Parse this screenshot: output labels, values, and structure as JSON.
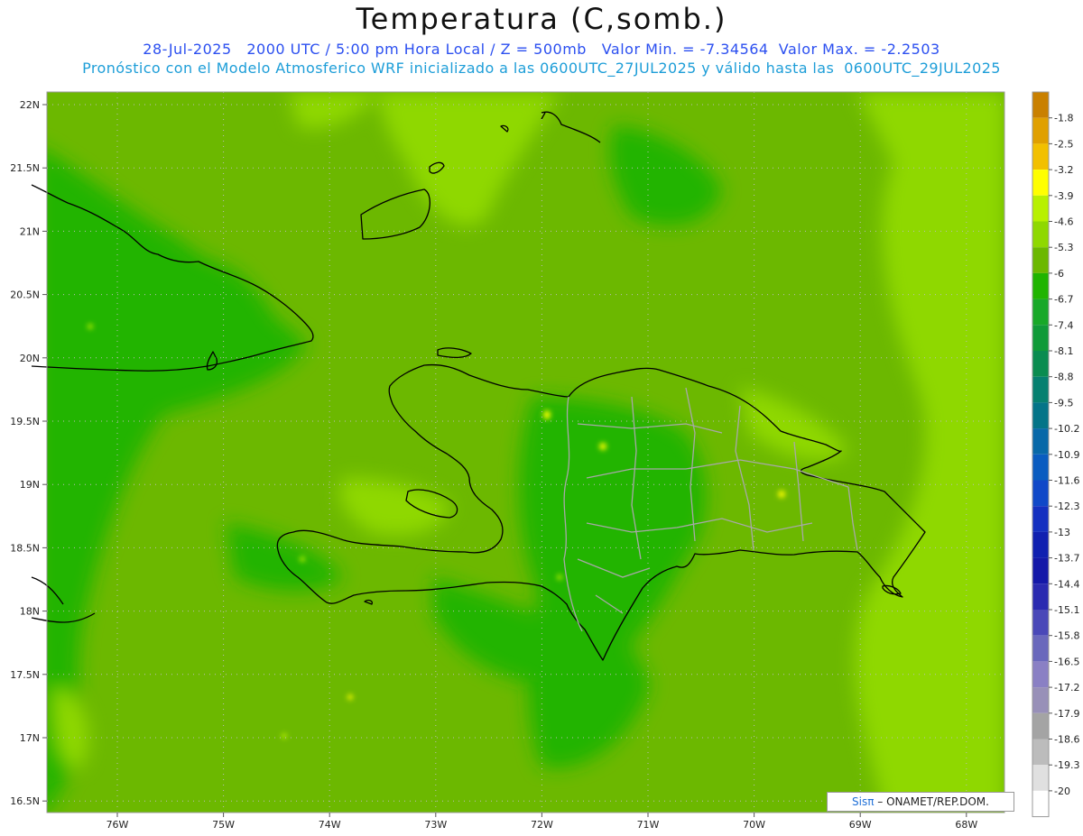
{
  "header": {
    "title": "Temperatura (C,somb.)",
    "line1": "28-Jul-2025   2000 UTC / 5:00 pm Hora Local / Z = 500mb   Valor Min. = -7.34564  Valor Max. = -2.2503",
    "line2": "Pronóstico con el Modelo Atmosferico WRF inicializado a las 0600UTC_27JUL2025 y válido hasta las  0600UTC_29JUL2025"
  },
  "axes": {
    "lat_labels": [
      "22N",
      "21.5N",
      "21N",
      "20.5N",
      "20N",
      "19.5N",
      "19N",
      "18.5N",
      "18N",
      "17.5N",
      "17N",
      "16.5N"
    ],
    "lon_labels": [
      "76W",
      "75W",
      "74W",
      "73W",
      "72W",
      "71W",
      "70W",
      "69W",
      "68W"
    ]
  },
  "legend": {
    "labels": [
      "-1.8",
      "-2.5",
      "-3.2",
      "-3.9",
      "-4.6",
      "-5.3",
      "-6",
      "-6.7",
      "-7.4",
      "-8.1",
      "-8.8",
      "-9.5",
      "-10.2",
      "-10.9",
      "-11.6",
      "-12.3",
      "-13",
      "-13.7",
      "-14.4",
      "-15.1",
      "-15.8",
      "-16.5",
      "-17.2",
      "-17.9",
      "-18.6",
      "-19.3",
      "-20"
    ],
    "colors": [
      "#c98000",
      "#e0a000",
      "#f2c000",
      "#ffff00",
      "#b8f000",
      "#8fd800",
      "#6cb800",
      "#20b400",
      "#18a828",
      "#109a38",
      "#0a8c50",
      "#068070",
      "#047488",
      "#0868a8",
      "#0a5cc0",
      "#1048c8",
      "#1430c0",
      "#1020b0",
      "#1418a8",
      "#2a2ab0",
      "#4a48b8",
      "#6a68bc",
      "#8a80c4",
      "#9890b8",
      "#a4a4a4",
      "#bcbcbc",
      "#e0e0e0",
      "#ffffff"
    ]
  },
  "credit": {
    "logo": "Sisπ",
    "text": " – ONAMET/REP.DOM."
  }
}
